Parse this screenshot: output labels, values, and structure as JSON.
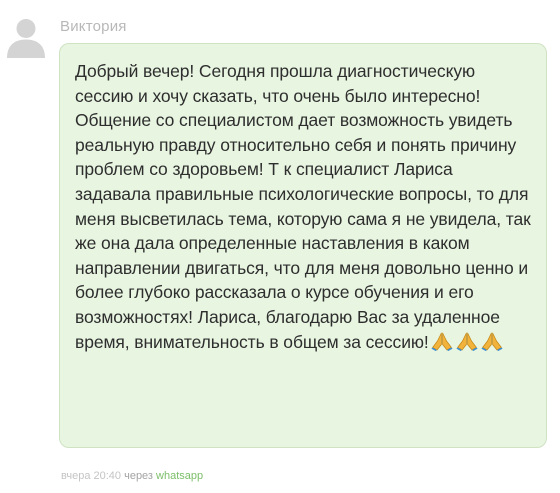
{
  "author": {
    "name": "Виктория",
    "avatar_icon": "user-silhouette-icon"
  },
  "message": {
    "text": "Добрый вечер! Сегодня прошла диагностическую сессию и хочу сказать, что очень было интересно! Общение со специалистом дает возможность увидеть реальную правду относительно себя и понять причину проблем со здоровьем! Т к специалист Лариса задавала правильные психологические вопросы, то для меня высветилась тема, которую сама я не увидела, так же она дала определенные наставления в каком направлении двигаться, что для меня довольно ценно и более глубоко рассказала о курсе обучения и его возможностях! Лариса, благодарю Вас за удаленное время, внимательность в общем за сессию!",
    "emoji": [
      "folded-hands-icon",
      "folded-hands-icon",
      "folded-hands-icon"
    ]
  },
  "footer": {
    "time": "вчера 20:40",
    "via": "через",
    "channel": "whatsapp"
  },
  "colors": {
    "bubble_background": "#e8f5e1",
    "bubble_border": "#cfe3c3",
    "channel_link": "#7cbf6a",
    "author_text": "#b8b8b8"
  }
}
